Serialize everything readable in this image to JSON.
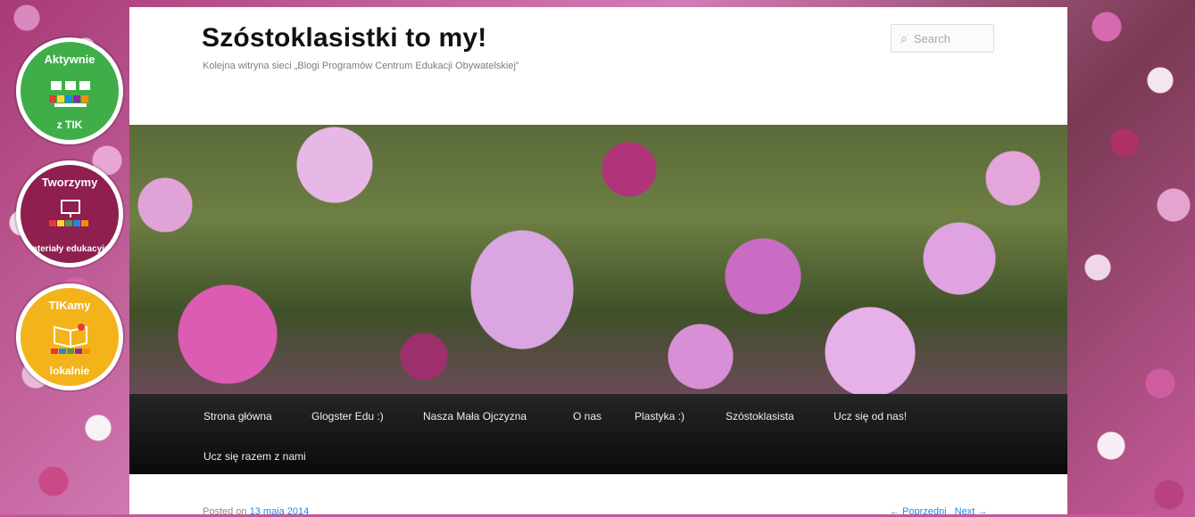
{
  "site": {
    "title": "Szóstoklasistki to my!",
    "description": "Kolejna witryna sieci „Blogi Programów Centrum Edukacji Obywatelskiej”"
  },
  "search": {
    "placeholder": "Search",
    "value": ""
  },
  "nav": {
    "items": [
      "Strona główna",
      "Glogster Edu :)",
      "Nasza Mała Ojczyzna",
      "O nas",
      "Plastyka :)",
      "Szóstoklasista",
      "Ucz się od nas!",
      "Ucz się razem z nami"
    ]
  },
  "post": {
    "posted_prefix": "Posted on",
    "date": "13 maja 2014",
    "prev_label": "← Poprzedni",
    "next_label": "Next →"
  },
  "badges": [
    {
      "top": "Aktywnie",
      "bottom": "z TIK",
      "color": "#3fae49"
    },
    {
      "top": "Tworzymy",
      "bottom": "materiały edukacyjne",
      "color": "#8e1f4f"
    },
    {
      "top": "TIKamy",
      "bottom": "lokalnie",
      "color": "#f3b31b"
    }
  ],
  "colors": {
    "nav_bg": "#111111",
    "link": "#1b8be0",
    "title": "#111111"
  }
}
